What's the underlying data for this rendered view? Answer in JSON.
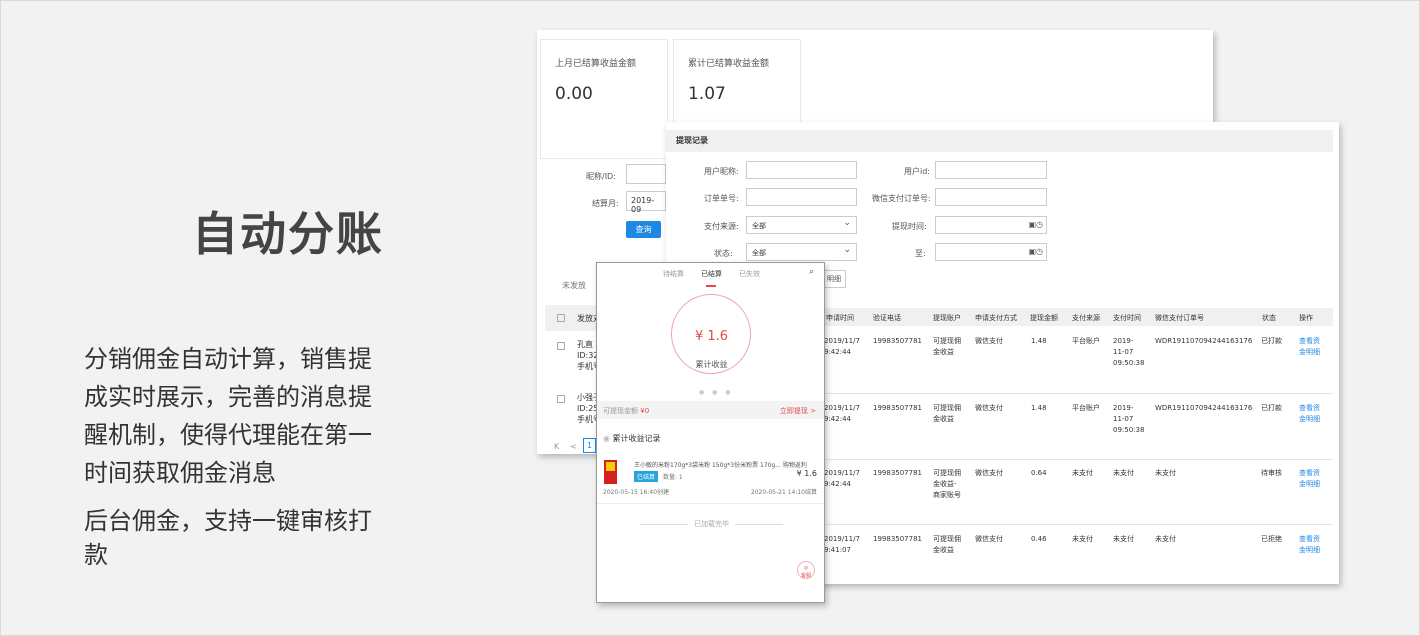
{
  "left": {
    "title": "自动分账",
    "desc_lines": [
      "分销佣金自动计算，销售提",
      "成实时展示，完善的消息提",
      "醒机制，使得代理能在第一",
      "时间获取佣金消息"
    ],
    "desc2_lines": [
      "后台佣金，支持一键审核打",
      "款"
    ]
  },
  "admin_back": {
    "card1_label": "上月已结算收益金额",
    "card1_value": "0.00",
    "card2_label": "累计已结算收益金额",
    "card2_value": "1.07",
    "nick_label": "昵称/ID:",
    "month_label": "结算月:",
    "month_value": "2019-09",
    "query_button": "查询",
    "tab": "未发放",
    "col_first": "发放对",
    "rows": [
      {
        "name": "孔直",
        "id": "ID:32",
        "phone": "手机号"
      },
      {
        "name": "小强子",
        "id": "ID:25",
        "phone": "手机号"
      }
    ],
    "pager": [
      "K",
      "<",
      "1"
    ]
  },
  "admin_front": {
    "section_title": "提现记录",
    "filters": {
      "user_nick_label": "用户昵称:",
      "user_id_label": "用户id:",
      "order_no_label": "订单单号:",
      "wechat_order_label": "微信支付订单号:",
      "pay_source_label": "支付来源:",
      "pay_source_value": "全部",
      "withdraw_time_label": "提现时间:",
      "status_label": "状态:",
      "status_value": "全部",
      "to_label": "至:",
      "detail_button": "明细"
    },
    "columns": [
      "申请时间",
      "验证电话",
      "提现账户",
      "申请支付方式",
      "提现金额",
      "支付来源",
      "支付时间",
      "微信支付订单号",
      "状态",
      "操作"
    ],
    "rows": [
      {
        "time": [
          "2019/11/7",
          "9:42:44"
        ],
        "phone": "19983507781",
        "account": [
          "可提现佣",
          "金收益"
        ],
        "method": "微信支付",
        "amount": "1.48",
        "source": "平台账户",
        "paytime": [
          "2019-",
          "11-07",
          "09:50:38"
        ],
        "order": "WDR191107094244163176",
        "status": "已打款",
        "op": [
          "查看资",
          "金明细"
        ]
      },
      {
        "time": [
          "2019/11/7",
          "9:42:44"
        ],
        "phone": "19983507781",
        "account": [
          "可提现佣",
          "金收益"
        ],
        "method": "微信支付",
        "amount": "1.48",
        "source": "平台账户",
        "paytime": [
          "2019-",
          "11-07",
          "09:50:38"
        ],
        "order": "WDR191107094244163176",
        "status": "已打款",
        "op": [
          "查看资",
          "金明细"
        ]
      },
      {
        "time": [
          "2019/11/7",
          "9:42:44"
        ],
        "phone": "19983507781",
        "account": [
          "可提现佣",
          "金收益-",
          "商家账号"
        ],
        "method": "微信支付",
        "amount": "0.64",
        "source": "未支付",
        "paytime": [
          "未支付"
        ],
        "order": "未支付",
        "status": "待审核",
        "op": [
          "查看资",
          "金明细"
        ]
      },
      {
        "time": [
          "2019/11/7",
          "9:41:07"
        ],
        "phone": "19983507781",
        "account": [
          "可提现佣",
          "金收益"
        ],
        "method": "微信支付",
        "amount": "0.46",
        "source": "未支付",
        "paytime": [
          "未支付"
        ],
        "order": "未支付",
        "status": "已拒绝",
        "op": [
          "查看资",
          "金明细"
        ]
      }
    ]
  },
  "mobile": {
    "tabs": [
      "待结算",
      "已结算",
      "已失效"
    ],
    "amount": "¥ 1.6",
    "amount_label": "累计收益",
    "available_label": "可提现金额",
    "available_value": "¥0",
    "withdraw_link": "立即提现 >",
    "records_label": "累计收益记录",
    "product_name": "王小敏的米粉170g*3袋米粉 150g*3份米粉票 170g... 购物返利",
    "badge": "已结算",
    "qty": "数量: 1",
    "price": "¥ 1.6",
    "created": "2020-05-15 16:40创建",
    "settled": "2020-05-21 14:10结算",
    "loaded": "已加载完毕",
    "help": "客服"
  },
  "colors": {
    "accent_blue": "#1e88e5",
    "accent_red": "#e04a4a",
    "badge_blue": "#29a3e0"
  }
}
